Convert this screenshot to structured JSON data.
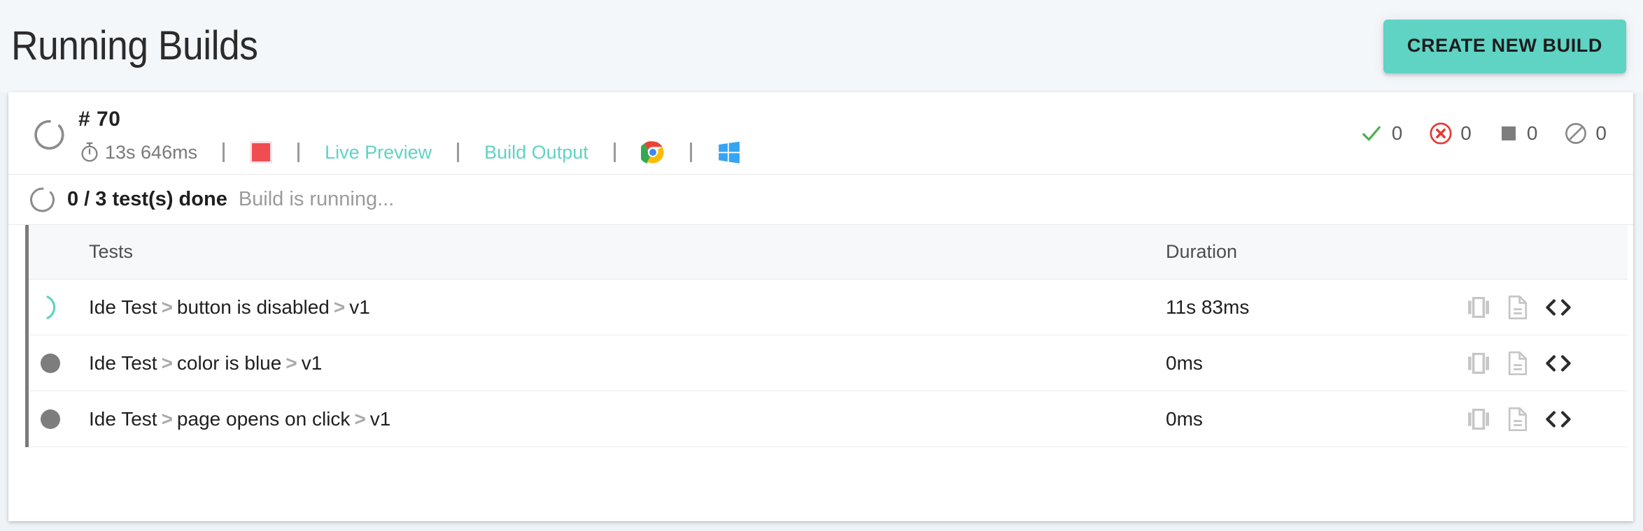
{
  "header": {
    "title": "Running Builds",
    "create_button": "CREATE NEW BUILD"
  },
  "build": {
    "id_label": "# 70",
    "duration": "13s 646ms",
    "stop_icon": "stop-square-icon",
    "spinner_icon": "running-spinner-icon",
    "timer_icon": "stopwatch-icon",
    "links": [
      {
        "label": "Live Preview",
        "name": "live-preview-link"
      },
      {
        "label": "Build Output",
        "name": "build-output-link"
      }
    ],
    "browsers": [
      {
        "name": "chrome-icon",
        "title": "Chrome"
      },
      {
        "name": "windows-icon",
        "title": "Windows"
      }
    ],
    "counters": [
      {
        "name": "passed-count",
        "icon": "check-icon",
        "value": "0",
        "color": "#4caf50"
      },
      {
        "name": "failed-count",
        "icon": "error-circle-icon",
        "value": "0",
        "color": "#e53935"
      },
      {
        "name": "stopped-count",
        "icon": "square-icon",
        "value": "0",
        "color": "#7d7d7d"
      },
      {
        "name": "skipped-count",
        "icon": "ban-icon",
        "value": "0",
        "color": "#8a8a8a"
      }
    ]
  },
  "progress": {
    "done_label": "0 / 3 test(s) done",
    "status_label": "Build is running..."
  },
  "table": {
    "columns": {
      "tests": "Tests",
      "duration": "Duration"
    },
    "rows": [
      {
        "status": "running",
        "name_prefix": "Ide Test",
        "name_middle": "button is disabled",
        "name_suffix": "v1",
        "duration": "11s 83ms"
      },
      {
        "status": "pending",
        "name_prefix": "Ide Test",
        "name_middle": "color is blue",
        "name_suffix": "v1",
        "duration": "0ms"
      },
      {
        "status": "pending",
        "name_prefix": "Ide Test",
        "name_middle": "page opens on click",
        "name_suffix": "v1",
        "duration": "0ms"
      }
    ],
    "row_actions": [
      {
        "name": "screenshots-icon"
      },
      {
        "name": "logs-document-icon"
      },
      {
        "name": "code-icon"
      }
    ]
  },
  "colors": {
    "accent_teal": "#5fd3c4",
    "danger_red": "#ef4d52",
    "page_bg": "#eef3f7"
  }
}
